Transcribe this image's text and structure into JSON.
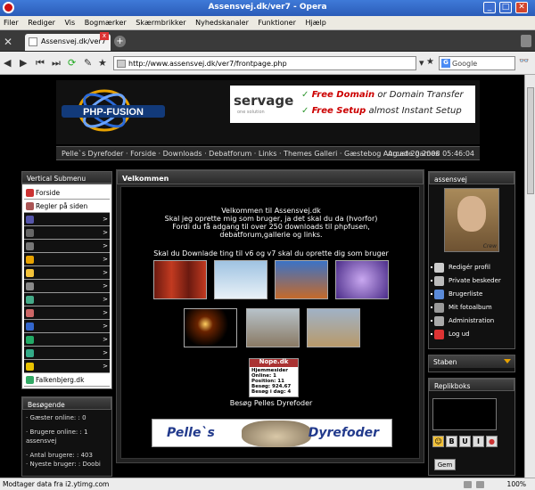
{
  "window": {
    "title": "Assensvej.dk/ver7 - Opera",
    "min": "_",
    "max": "□",
    "close": "✕"
  },
  "menu": [
    "Filer",
    "Rediger",
    "Vis",
    "Bogmærker",
    "Skærmbrikker",
    "Nyhedskanaler",
    "Funktioner",
    "Hjælp"
  ],
  "tab": {
    "label": "Assensvej.dk/ver7",
    "close": "x",
    "new": "+"
  },
  "nav": {
    "url": "http://www.assensvej.dk/ver7/frontpage.php",
    "search_placeholder": "Google"
  },
  "banner": {
    "brand": "servage",
    "sub": "one solution",
    "line1_strong": "Free Domain",
    "line1_rest": " or Domain Transfer",
    "line2_strong": "Free Setup",
    "line2_rest": " almost Instant Setup",
    "check": "✓"
  },
  "logo": {
    "text": "PHP-FUSION"
  },
  "navlinks": "Pelle`s Dyrefoder · Forside · Downloads · Debatforum · Links · Themes Galleri · Gæstebog · Arcade games",
  "date": "August 20 2008 05:46:04",
  "left": {
    "submenu_title": "Vertical Submenu",
    "items": [
      {
        "label": "Forside",
        "style": "light"
      },
      {
        "label": "Regler på siden",
        "style": "light"
      },
      {
        "label": "",
        "style": "dark"
      },
      {
        "label": "",
        "style": "dark"
      },
      {
        "label": "",
        "style": "dark"
      },
      {
        "label": "",
        "style": "dark"
      },
      {
        "label": "",
        "style": "dark"
      },
      {
        "label": "",
        "style": "dark"
      },
      {
        "label": "",
        "style": "dark"
      },
      {
        "label": "",
        "style": "dark"
      },
      {
        "label": "",
        "style": "dark"
      },
      {
        "label": "",
        "style": "dark"
      },
      {
        "label": "",
        "style": "dark"
      },
      {
        "label": "",
        "style": "dark"
      },
      {
        "label": "Falkenbjerg.dk",
        "style": "light"
      }
    ],
    "arrow": ">",
    "besog_title": "Besøgende",
    "besog_lines": [
      "· Gæster online: : 0",
      "· Brugere online: : 1 assensvej",
      "· Antal brugere: : 403",
      "· Nyeste bruger: : Doobi"
    ]
  },
  "center": {
    "title": "Velkommen",
    "welcome": [
      "Velkommen til Assensvej.dk",
      "Skal jeg oprette mig som bruger, ja det skal du da (hvorfor)",
      "Fordi du få adgang til over 250 downloads til phpfusen,",
      "debatforum,gallerie og links."
    ],
    "download_note": "Skal du Downlade ting til v6 og v7 skal du oprette dig som bruger",
    "counter": {
      "head": "Nope.dk",
      "lines": [
        "Hjemmesider",
        "Online:    1",
        "Position:   11",
        "Besøg:   924.67",
        "Besøg i dag:   4"
      ]
    },
    "pelles_caption": "Besøg Pelles Dyrefoder",
    "dyre_left": "Pelle`s",
    "dyre_right": "Dyrefoder"
  },
  "right": {
    "user_title": "assensvej",
    "avatar_caption": "Crew",
    "items": [
      "Redigér profil",
      "Private beskeder",
      "Brugerliste",
      "Mit fotoalbum",
      "Administration",
      "Log ud"
    ],
    "staben_title": "Staben",
    "repl_title": "Replikboks",
    "format_buttons": [
      "☺",
      "B",
      "U",
      "I",
      "●"
    ],
    "gem": "Gem"
  },
  "status": {
    "msg": "Modtager data fra i2.ytimg.com",
    "zoom": "100%"
  },
  "colors": {
    "accent": "#3f7ad8",
    "banner_red": "#c00",
    "page_bg": "#000"
  }
}
